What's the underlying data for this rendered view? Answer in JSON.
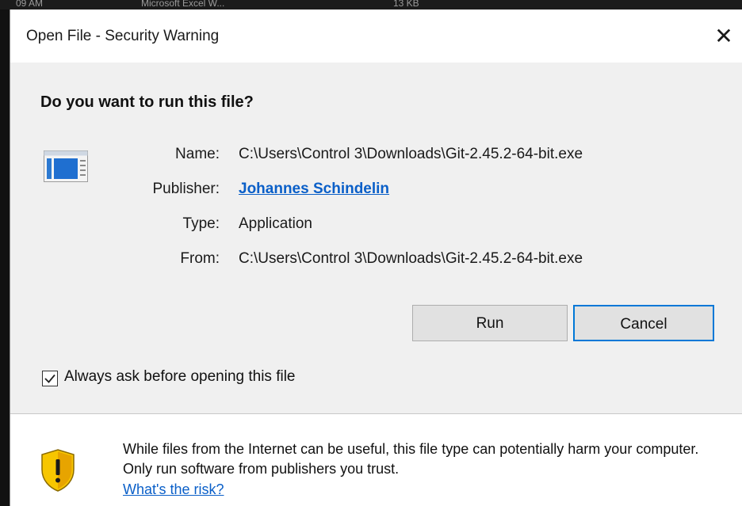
{
  "background": {
    "col1": "09 AM",
    "col2": "Microsoft Excel W...",
    "col3": "13 KB"
  },
  "dialog": {
    "title": "Open File - Security Warning",
    "close_glyph": "✕",
    "question": "Do you want to run this file?",
    "fields": {
      "name_label": "Name:",
      "name_value": "C:\\Users\\Control 3\\Downloads\\Git-2.45.2-64-bit.exe",
      "publisher_label": "Publisher:",
      "publisher_value": "Johannes Schindelin",
      "type_label": "Type:",
      "type_value": "Application",
      "from_label": "From:",
      "from_value": "C:\\Users\\Control 3\\Downloads\\Git-2.45.2-64-bit.exe"
    },
    "buttons": {
      "run": "Run",
      "cancel": "Cancel"
    },
    "checkbox": {
      "label": "Always ask before opening this file",
      "checked": true
    },
    "warning": {
      "text": "While files from the Internet can be useful, this file type can potentially harm your computer. Only run software from publishers you trust.",
      "link": "What's the risk?"
    },
    "icons": {
      "file": "application-window-icon",
      "warning": "warning-shield-icon"
    },
    "colors": {
      "accent": "#0078d7",
      "link": "#0a5fc8",
      "shield": "#f5b800"
    }
  }
}
